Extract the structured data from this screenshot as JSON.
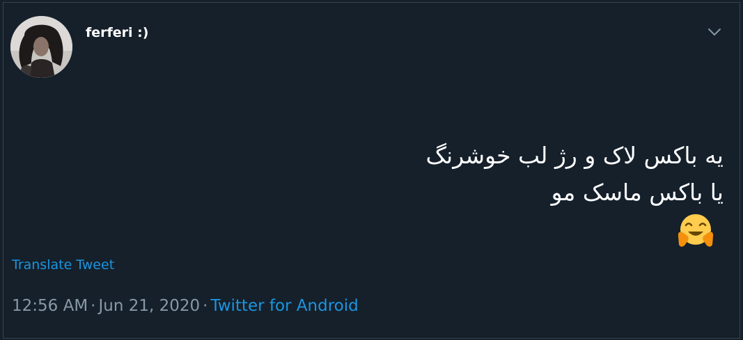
{
  "tweet": {
    "display_name": "ferferi :)",
    "text_lines": [
      "یه باکس لاک و رژ لب خوشرنگ",
      "یا باکس ماسک مو"
    ],
    "emoji": "🤗",
    "translate_label": "Translate Tweet",
    "time": "12:56 AM",
    "date": "Jun 21, 2020",
    "separator": "·",
    "source": "Twitter for Android"
  },
  "icons": {
    "caret": "chevron-down-icon",
    "emoji": "hugging-face-icon"
  },
  "colors": {
    "background": "#15202b",
    "border": "#38444d",
    "text_primary": "#ffffff",
    "text_secondary": "#8899a6",
    "link": "#1b95e0"
  }
}
